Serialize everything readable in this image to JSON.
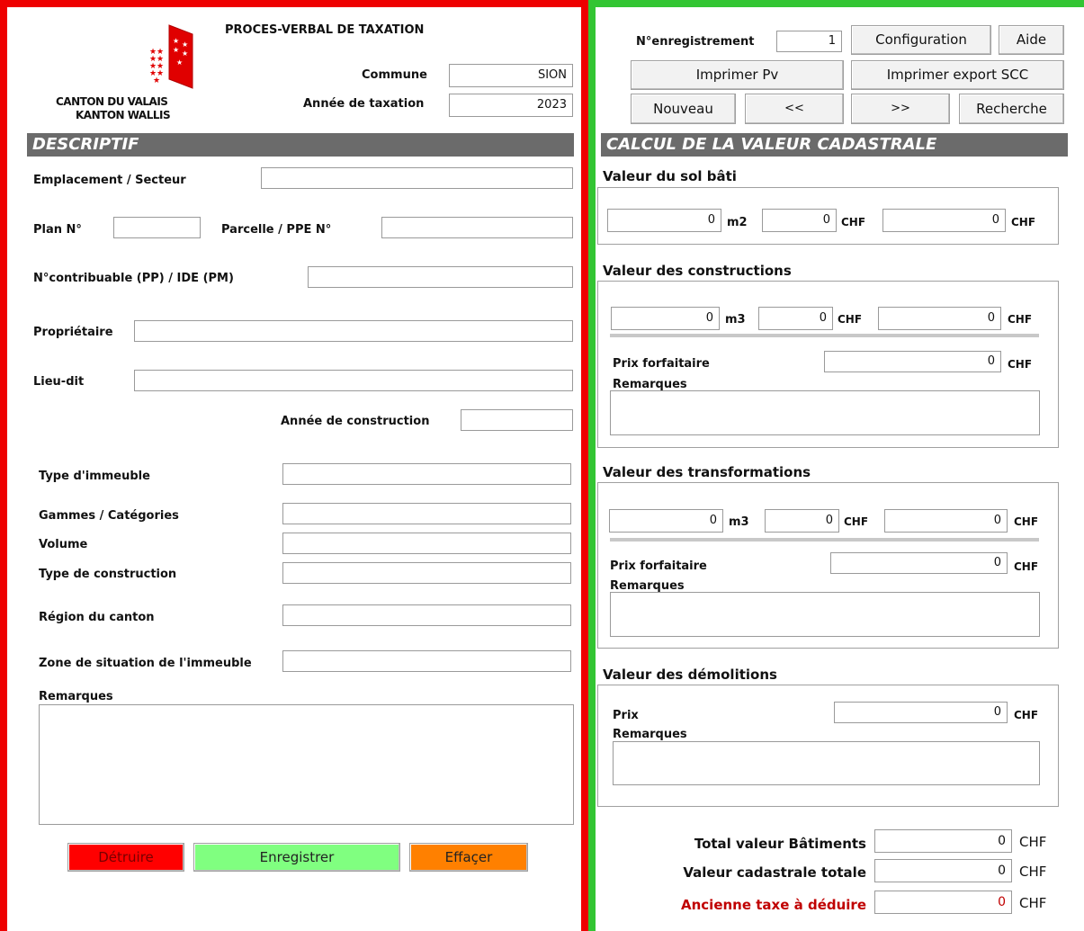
{
  "header": {
    "title": "PROCES-VERBAL DE TAXATION",
    "logo_line1": "CANTON DU VALAIS",
    "logo_line2": "KANTON WALLIS",
    "commune_label": "Commune",
    "commune_value": "SION",
    "annee_label": "Année de taxation",
    "annee_value": "2023"
  },
  "descriptif": {
    "title": "DESCRIPTIF",
    "emplacement_label": "Emplacement / Secteur",
    "plan_label": "Plan N°",
    "parcelle_label": "Parcelle / PPE N°",
    "contribuable_label": "N°contribuable (PP) / IDE (PM)",
    "proprietaire_label": "Propriétaire",
    "lieudit_label": "Lieu-dit",
    "annee_construction_label": "Année de construction",
    "type_immeuble_label": "Type d'immeuble",
    "gammes_label": "Gammes / Catégories",
    "volume_label": "Volume",
    "type_construction_label": "Type de construction",
    "region_label": "Région du canton",
    "zone_label": "Zone de situation de l'immeuble",
    "remarques_label": "Remarques"
  },
  "actions": {
    "detruire": "Détruire",
    "enregistrer": "Enregistrer",
    "effacer": "Effaçer"
  },
  "toolbar": {
    "enregistrement_label": "N°enregistrement",
    "enregistrement_value": "1",
    "configuration": "Configuration",
    "aide": "Aide",
    "imprimer_pv": "Imprimer Pv",
    "imprimer_export": "Imprimer export SCC",
    "nouveau": "Nouveau",
    "prev": "<<",
    "next": ">>",
    "recherche": "Recherche"
  },
  "calcul": {
    "title": "CALCUL DE LA VALEUR CADASTRALE",
    "sol": {
      "title": "Valeur du sol bâti",
      "v1": "0",
      "u1": "m2",
      "v2": "0",
      "u2": "CHF",
      "v3": "0",
      "u3": "CHF"
    },
    "constructions": {
      "title": "Valeur des constructions",
      "v1": "0",
      "u1": "m3",
      "v2": "0",
      "u2": "CHF",
      "v3": "0",
      "u3": "CHF",
      "prix_label": "Prix forfaitaire",
      "prix_value": "0",
      "prix_unit": "CHF",
      "remarques_label": "Remarques"
    },
    "transformations": {
      "title": "Valeur des transformations",
      "v1": "0",
      "u1": "m3",
      "v2": "0",
      "u2": "CHF",
      "v3": "0",
      "u3": "CHF",
      "prix_label": "Prix forfaitaire",
      "prix_value": "0",
      "prix_unit": "CHF",
      "remarques_label": "Remarques"
    },
    "demolitions": {
      "title": "Valeur des démolitions",
      "prix_label": "Prix",
      "prix_value": "0",
      "prix_unit": "CHF",
      "remarques_label": "Remarques"
    }
  },
  "totals": {
    "batiments_label": "Total valeur Bâtiments",
    "batiments_value": "0",
    "cadastrale_label": "Valeur cadastrale totale",
    "cadastrale_value": "0",
    "ancienne_label": "Ancienne taxe à déduire",
    "ancienne_value": "0",
    "unit": "CHF"
  },
  "colors": {
    "left_border": "#e00000",
    "right_border": "#33c533",
    "section_bar": "#6b6b6b",
    "detruire_bg": "#ff0000",
    "enregistrer_bg": "#80ff80",
    "effacer_bg": "#ff8000",
    "ancienne_text": "#c00000"
  }
}
